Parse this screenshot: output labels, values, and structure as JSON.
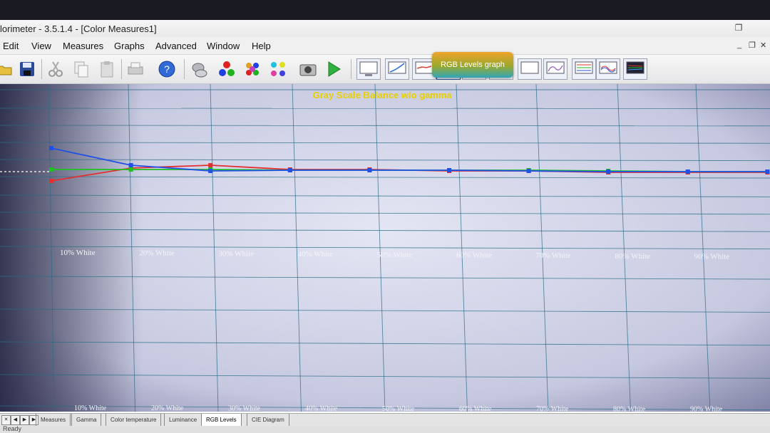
{
  "window": {
    "title": "lorimeter - 3.5.1.4 - [Color Measures1]"
  },
  "menu": [
    {
      "label": "Edit"
    },
    {
      "label": "View"
    },
    {
      "label": "Measures"
    },
    {
      "label": "Graphs"
    },
    {
      "label": "Advanced"
    },
    {
      "label": "Window"
    },
    {
      "label": "Help"
    }
  ],
  "tooltip": "RGB Levels graph",
  "chart_data": {
    "type": "line",
    "title": "Gray Scale Balance w/o gamma",
    "categories": [
      "10% White",
      "20% White",
      "30% White",
      "40% White",
      "50% White",
      "60% White",
      "70% White",
      "80% White",
      "90% White",
      "100% White"
    ],
    "series": [
      {
        "color": "#e03030",
        "values": [
          92,
          101,
          103,
          100,
          100,
          99,
          99,
          98,
          98,
          98
        ]
      },
      {
        "color": "#20c020",
        "values": [
          100,
          100,
          100,
          99.5,
          99.5,
          99.5,
          99.5,
          99,
          98.5,
          98.5
        ]
      },
      {
        "color": "#2050e8",
        "values": [
          115,
          103,
          99,
          99.5,
          99.5,
          99.5,
          99,
          98.5,
          98.5,
          98.5
        ]
      }
    ],
    "delta_series": {
      "color": "#c050c0",
      "values": [
        4.5,
        3.5,
        3.2,
        2.5,
        4.2,
        4.2,
        3.5,
        3.4,
        3.0
      ]
    },
    "grid": true,
    "colors": {
      "title": "#e8d000",
      "grid": "#2a6b86",
      "reference": "#ffffff"
    }
  },
  "tabs": [
    {
      "label": "Measures"
    },
    {
      "label": "Gamma"
    },
    {
      "label": "Color temperature"
    },
    {
      "label": "Luminance"
    },
    {
      "label": "RGB Levels"
    },
    {
      "label": "CIE Diagram"
    }
  ],
  "status": "Ready"
}
